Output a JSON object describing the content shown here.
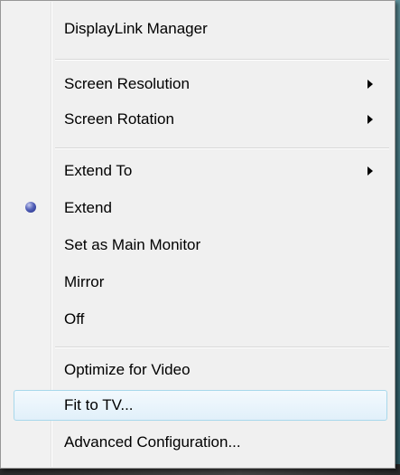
{
  "menu": {
    "items": [
      {
        "label": "DisplayLink Manager"
      },
      {
        "label": "Screen Resolution",
        "has_submenu": true
      },
      {
        "label": "Screen Rotation",
        "has_submenu": true
      },
      {
        "label": "Extend To",
        "has_submenu": true
      },
      {
        "label": "Extend",
        "checked": true,
        "indicator": "radio-dot-icon"
      },
      {
        "label": "Set as Main Monitor"
      },
      {
        "label": "Mirror"
      },
      {
        "label": "Off"
      },
      {
        "label": "Optimize for Video"
      },
      {
        "label": "Fit to TV...",
        "highlighted": true
      },
      {
        "label": "Advanced Configuration..."
      }
    ],
    "icons": {
      "submenu_arrow": "chevron-right-icon",
      "radio": "radio-dot-icon"
    },
    "colors": {
      "background": "#f0f0f0",
      "hover_border": "#a8d8eb",
      "hover_fill": "#e1f0fa",
      "radio_dot": "#3b47a8"
    }
  }
}
